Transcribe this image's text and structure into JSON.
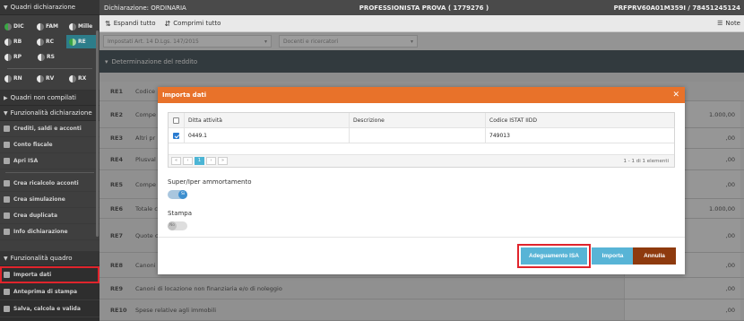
{
  "sidebar": {
    "quadri_title": "Quadri dichiarazione",
    "chips_row1": [
      {
        "label": "DIC",
        "color": "#3aa645",
        "selected": false
      },
      {
        "label": "FAM",
        "color": "#e8e8e8",
        "selected": false
      },
      {
        "label": "Mille",
        "color": "#e8e8e8",
        "selected": false
      }
    ],
    "chips_row2": [
      {
        "label": "RB",
        "color": "#e8e8e8",
        "selected": false
      },
      {
        "label": "RC",
        "color": "#e8e8e8",
        "selected": false
      },
      {
        "label": "RE",
        "color": "#3aa645",
        "selected": true
      }
    ],
    "chips_row3": [
      {
        "label": "RP",
        "color": "#e8e8e8",
        "selected": false
      },
      {
        "label": "RS",
        "color": "#e8e8e8",
        "selected": false
      }
    ],
    "chips_row4": [
      {
        "label": "RN",
        "color": "#e8e8e8",
        "selected": false
      },
      {
        "label": "RV",
        "color": "#e8e8e8",
        "selected": false
      },
      {
        "label": "RX",
        "color": "#e8e8e8",
        "selected": false
      }
    ],
    "non_compilati": "Quadri non compilati",
    "funz_dichiarazione": "Funzionalità dichiarazione",
    "menu": [
      "Crediti, saldi e acconti",
      "Conto fiscale",
      "Apri ISA",
      "Crea ricalcolo acconti",
      "Crea simulazione",
      "Crea duplicata",
      "Info dichiarazione"
    ],
    "funz_quadro": "Funzionalità quadro",
    "bottom_menu": [
      "Importa dati",
      "Anteprima di stampa",
      "Salva, calcola e valida"
    ]
  },
  "topbar": {
    "left": "Dichiarazione: ORDINARIA",
    "center": "PROFESSIONISTA PROVA ( 1779276 )",
    "right": "PRFPRV60A01M359I / 78451245124"
  },
  "toolbar": {
    "expand": "Espandi tutto",
    "collapse": "Comprimi tutto",
    "notes": "Note"
  },
  "content": {
    "filter1": "Impostati Art. 14 D.Lgs. 147/2015",
    "filter2": "Docenti e ricercatori",
    "section": "Determinazione del reddito",
    "rows": [
      {
        "code": "RE1",
        "desc": "Codice",
        "value": ""
      },
      {
        "code": "RE2",
        "desc": "Compe",
        "value": "1.000,00"
      },
      {
        "code": "RE3",
        "desc": "Altri pr",
        "value": ",00"
      },
      {
        "code": "RE4",
        "desc": "Plusval",
        "value": ",00"
      },
      {
        "code": "RE5",
        "desc": "Compe",
        "value": ",00"
      },
      {
        "code": "RE6",
        "desc": "Totale c",
        "value": "1.000,00"
      },
      {
        "code": "RE7",
        "desc": "Quote c",
        "value": ",00"
      },
      {
        "code": "RE8",
        "desc": "Canoni",
        "value": ",00"
      },
      {
        "code": "RE9",
        "desc": "Canoni di locazione non finanziaria e/o di noleggio",
        "value": ",00"
      },
      {
        "code": "RE10",
        "desc": "Spese relative agli immobili",
        "value": ",00"
      }
    ]
  },
  "modal": {
    "title": "Importa dati",
    "columns": [
      "Ditta attività",
      "Descrizione",
      "Codice ISTAT IIDD"
    ],
    "rows": [
      {
        "ditta": "0449.1",
        "descrizione": "",
        "istat": "749013",
        "checked": true
      }
    ],
    "pager": {
      "current": "1",
      "info": "1 - 1 di 1 elementi"
    },
    "option1": {
      "label": "Super/Iper ammortamento",
      "state": "Si"
    },
    "option2": {
      "label": "Stampa",
      "state": "No"
    },
    "buttons": {
      "isa": "Adeguamento ISA",
      "import": "Importa",
      "cancel": "Annulla"
    }
  }
}
